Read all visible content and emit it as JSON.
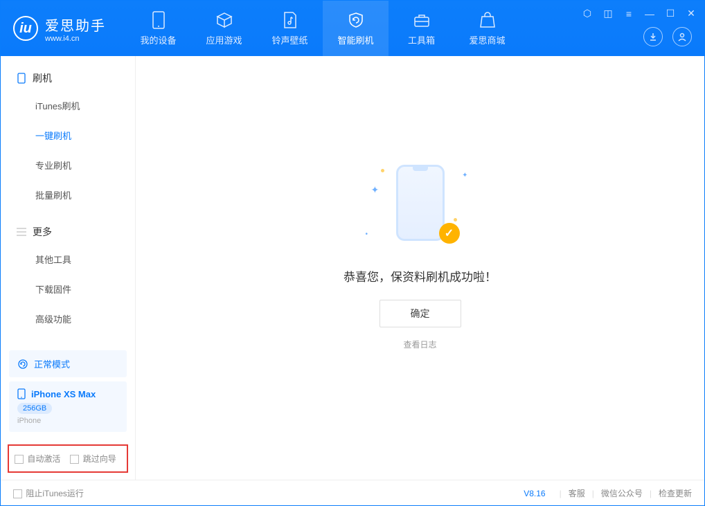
{
  "app": {
    "name": "爱思助手",
    "url": "www.i4.cn"
  },
  "tabs": [
    {
      "label": "我的设备"
    },
    {
      "label": "应用游戏"
    },
    {
      "label": "铃声壁纸"
    },
    {
      "label": "智能刷机"
    },
    {
      "label": "工具箱"
    },
    {
      "label": "爱思商城"
    }
  ],
  "sidebar": {
    "section1": {
      "title": "刷机",
      "items": [
        {
          "label": "iTunes刷机"
        },
        {
          "label": "一键刷机"
        },
        {
          "label": "专业刷机"
        },
        {
          "label": "批量刷机"
        }
      ]
    },
    "section2": {
      "title": "更多",
      "items": [
        {
          "label": "其他工具"
        },
        {
          "label": "下载固件"
        },
        {
          "label": "高级功能"
        }
      ]
    }
  },
  "mode": {
    "label": "正常模式"
  },
  "device": {
    "name": "iPhone XS Max",
    "storage": "256GB",
    "type": "iPhone"
  },
  "checks": {
    "auto_activate": "自动激活",
    "skip_wizard": "跳过向导"
  },
  "main": {
    "message": "恭喜您，保资料刷机成功啦！",
    "ok": "确定",
    "view_log": "查看日志"
  },
  "footer": {
    "block_itunes": "阻止iTunes运行",
    "version": "V8.16",
    "links": [
      "客服",
      "微信公众号",
      "检查更新"
    ]
  }
}
